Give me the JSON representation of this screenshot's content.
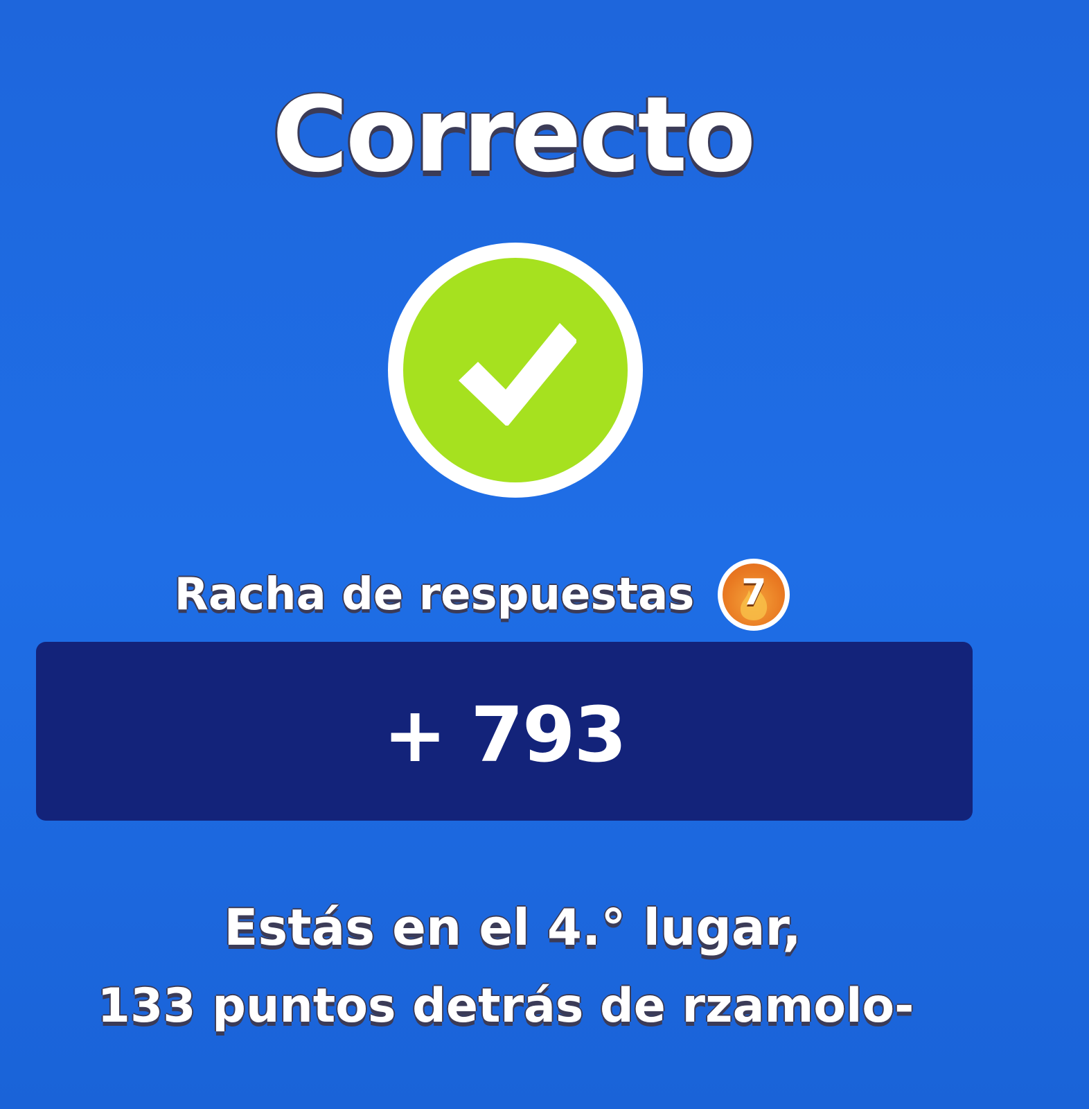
{
  "result": {
    "title": "Correcto",
    "status_icon": "checkmark-icon",
    "colors": {
      "background": "#1f6be0",
      "check_fill": "#a6e11f",
      "points_bar": "#13237a",
      "streak_badge": "#e97a22"
    }
  },
  "streak": {
    "label": "Racha de respuestas",
    "count": "7",
    "icon": "flame-icon"
  },
  "points": {
    "value": "+ 793"
  },
  "rank": {
    "line1": "Estás en el 4.° lugar,",
    "line2": "133 puntos detrás de rzamolo-"
  }
}
